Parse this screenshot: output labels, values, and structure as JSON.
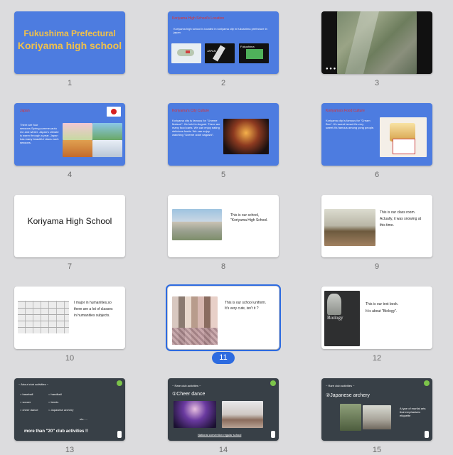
{
  "slides": [
    {
      "number": "1",
      "title1": "Fukushima Prefectural",
      "title2": "Koriyama high school"
    },
    {
      "number": "2",
      "heading": "Koriyama High School's Location",
      "text": "Koriyama high school is located in koriyama city in fukushima prefecture in japan.",
      "map_label1": "JAPAN",
      "map_label2": "Fukushima"
    },
    {
      "number": "3"
    },
    {
      "number": "4",
      "heading": "Japan",
      "text": "There are four seasons.Spring,summer,autu mn and winter. Japan's climate is warm through a year. Japan has many beautiful views each seasons."
    },
    {
      "number": "5",
      "heading": "Koriyama's City Culture",
      "text": "Koriyama city is famous for \"Uneme Matsuri\". It's held in August. There are many food carts. We can enjoy eating delicious foods. We can enjoy watching \"Uneme odori nagashi\"."
    },
    {
      "number": "6",
      "heading": "Koriyama's Food Culture",
      "text": "Koriyama city is famous for \"Cream Box\". It's sweet bread.It's very sweet.It's famous among yong people."
    },
    {
      "number": "7",
      "title": "Koriyama High School"
    },
    {
      "number": "8",
      "text1": "This is our school,",
      "text2": "\"Koriyama High School."
    },
    {
      "number": "9",
      "text1": "This is our class room.",
      "text2": "Actually, it was snowing at",
      "text3": "this time."
    },
    {
      "number": "10",
      "text1": "I major in humanities,so",
      "text2": "there are a lot of classes",
      "text3": "in humanities subjects."
    },
    {
      "number": "11",
      "text1": "This is our school uniform.",
      "text2": "It's very cute,  isn't it ?"
    },
    {
      "number": "12",
      "text1": "This is our text book.",
      "text2": "It is about \"Biology\".",
      "book_title": "Biology"
    },
    {
      "number": "13",
      "heading": "~ About club activities ~",
      "items": [
        "baseball",
        "handball",
        "soccer",
        "tennis",
        "cheer dance",
        "Japanese archery"
      ],
      "etc": "etc.....",
      "footer": "more than \"20\" club activities !!"
    },
    {
      "number": "14",
      "heading": "~ Rare club activities ~",
      "subheading": "①Cheer dance",
      "caption": "National convention regular school"
    },
    {
      "number": "15",
      "heading": "~ Rare club activities ~",
      "subheading": "②Japanese archery",
      "caption": "A type of martial arts that emphasizes etiquette"
    }
  ],
  "selected_slide": "11",
  "colors": {
    "accent": "#2d6be0",
    "slide_blue": "#4d7ce0",
    "title_orange": "#f1c14a",
    "heading_red": "#e03030"
  }
}
